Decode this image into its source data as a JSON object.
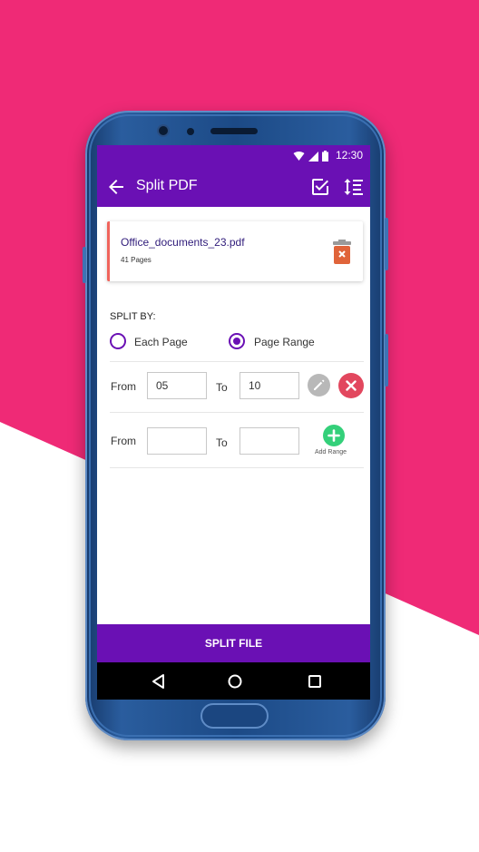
{
  "colors": {
    "background_pink": "#ef2a76",
    "app_purple": "#6a10b4",
    "card_accent": "#f0645c",
    "delete_icon": "#e0643a",
    "edit_gray": "#b8b8b8",
    "remove_red": "#e2475e",
    "add_green": "#34d07a"
  },
  "status_bar": {
    "time": "12:30",
    "icons": [
      "wifi-icon",
      "cellular-signal-icon",
      "battery-icon"
    ]
  },
  "app_bar": {
    "back_icon": "arrow-left-icon",
    "title": "Split PDF",
    "actions": [
      "select-all-check-icon",
      "sort-icon"
    ]
  },
  "file": {
    "name": "Office_documents_23.pdf",
    "pages": "41 Pages",
    "delete_icon": "trash-icon"
  },
  "split_by": {
    "label": "SPLIT BY:",
    "options": [
      {
        "label": "Each Page",
        "selected": false
      },
      {
        "label": "Page Range",
        "selected": true
      }
    ]
  },
  "ranges": [
    {
      "from_label": "From",
      "from_value": "05",
      "to_label": "To",
      "to_value": "10",
      "actions": [
        "pencil-icon",
        "close-icon"
      ]
    },
    {
      "from_label": "From",
      "from_value": "",
      "to_label": "To",
      "to_value": "",
      "actions": [
        "plus-icon"
      ],
      "add_label": "Add Range"
    }
  ],
  "footer": {
    "split_button": "SPLIT FILE"
  },
  "nav_bar": {
    "icons": [
      "back-triangle-icon",
      "home-circle-icon",
      "recents-square-icon"
    ]
  }
}
